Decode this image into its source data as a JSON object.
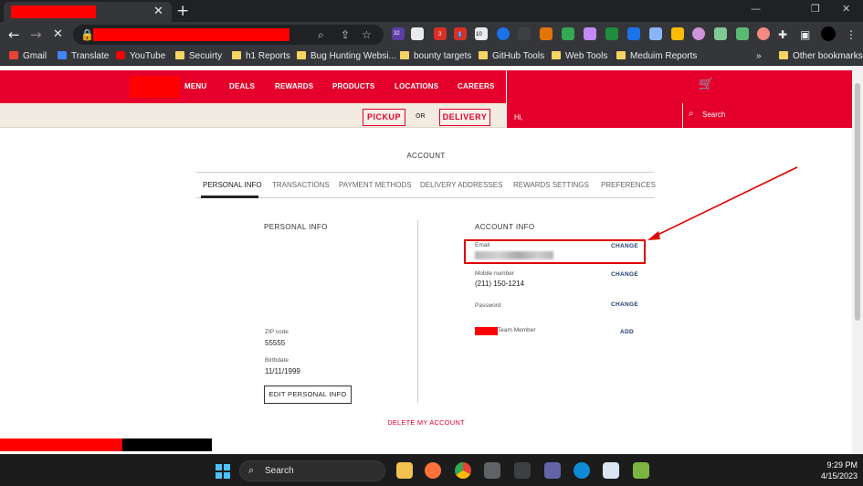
{
  "browser": {
    "tab_close": "✕",
    "new_tab": "+",
    "window_controls": [
      "—",
      "❐",
      "✕"
    ],
    "nav": {
      "back": "←",
      "forward": "→",
      "reload": "✕"
    }
  },
  "bookmarks": [
    {
      "label": "Gmail",
      "color": "#ea4335"
    },
    {
      "label": "Translate",
      "color": "#4285f4"
    },
    {
      "label": "YouTube",
      "color": "#ff0000"
    },
    {
      "label": "Secuirty",
      "color": "#f6d365"
    },
    {
      "label": "h1 Reports",
      "color": "#f6d365"
    },
    {
      "label": "Bug Hunting Websi...",
      "color": "#f6d365"
    },
    {
      "label": "bounty targets",
      "color": "#f6d365"
    },
    {
      "label": "GitHub Tools",
      "color": "#f6d365"
    },
    {
      "label": "Web Tools",
      "color": "#f6d365"
    },
    {
      "label": "Meduim Reports",
      "color": "#f6d365"
    }
  ],
  "bookmarks_more": "»",
  "bookmarks_other": "Other bookmarks",
  "extension_badges": [
    "32",
    "3",
    "1",
    "10"
  ],
  "site": {
    "brand_color": "#e4002b",
    "nav": [
      "MENU",
      "DEALS",
      "REWARDS",
      "PRODUCTS",
      "LOCATIONS",
      "CAREERS"
    ],
    "greeting": "Hi,",
    "pickup": "PICKUP",
    "or": "OR",
    "delivery": "DELIVERY",
    "search_label": "Search"
  },
  "account": {
    "title": "ACCOUNT",
    "tabs": [
      "PERSONAL INFO",
      "TRANSACTIONS",
      "PAYMENT METHODS",
      "DELIVERY ADDRESSES",
      "REWARDS SETTINGS",
      "PREFERENCES"
    ],
    "active_tab": "PERSONAL INFO",
    "personal": {
      "heading": "PERSONAL INFO",
      "zip_label": "ZIP code",
      "zip_value": "55555",
      "birthdate_label": "Birthdate",
      "birthdate_value": "11/11/1999",
      "edit_button": "EDIT PERSONAL INFO"
    },
    "info": {
      "heading": "ACCOUNT INFO",
      "email_label": "Email",
      "mobile_label": "Mobile number",
      "mobile_value": "(211) 150-1214",
      "password_label": "Password",
      "team_label": "Team Member",
      "change": "CHANGE",
      "add": "ADD"
    },
    "delete_link": "DELETE MY ACCOUNT"
  },
  "taskbar": {
    "search_label": "Search",
    "time": "9:29 PM",
    "date": "4/15/2023"
  }
}
